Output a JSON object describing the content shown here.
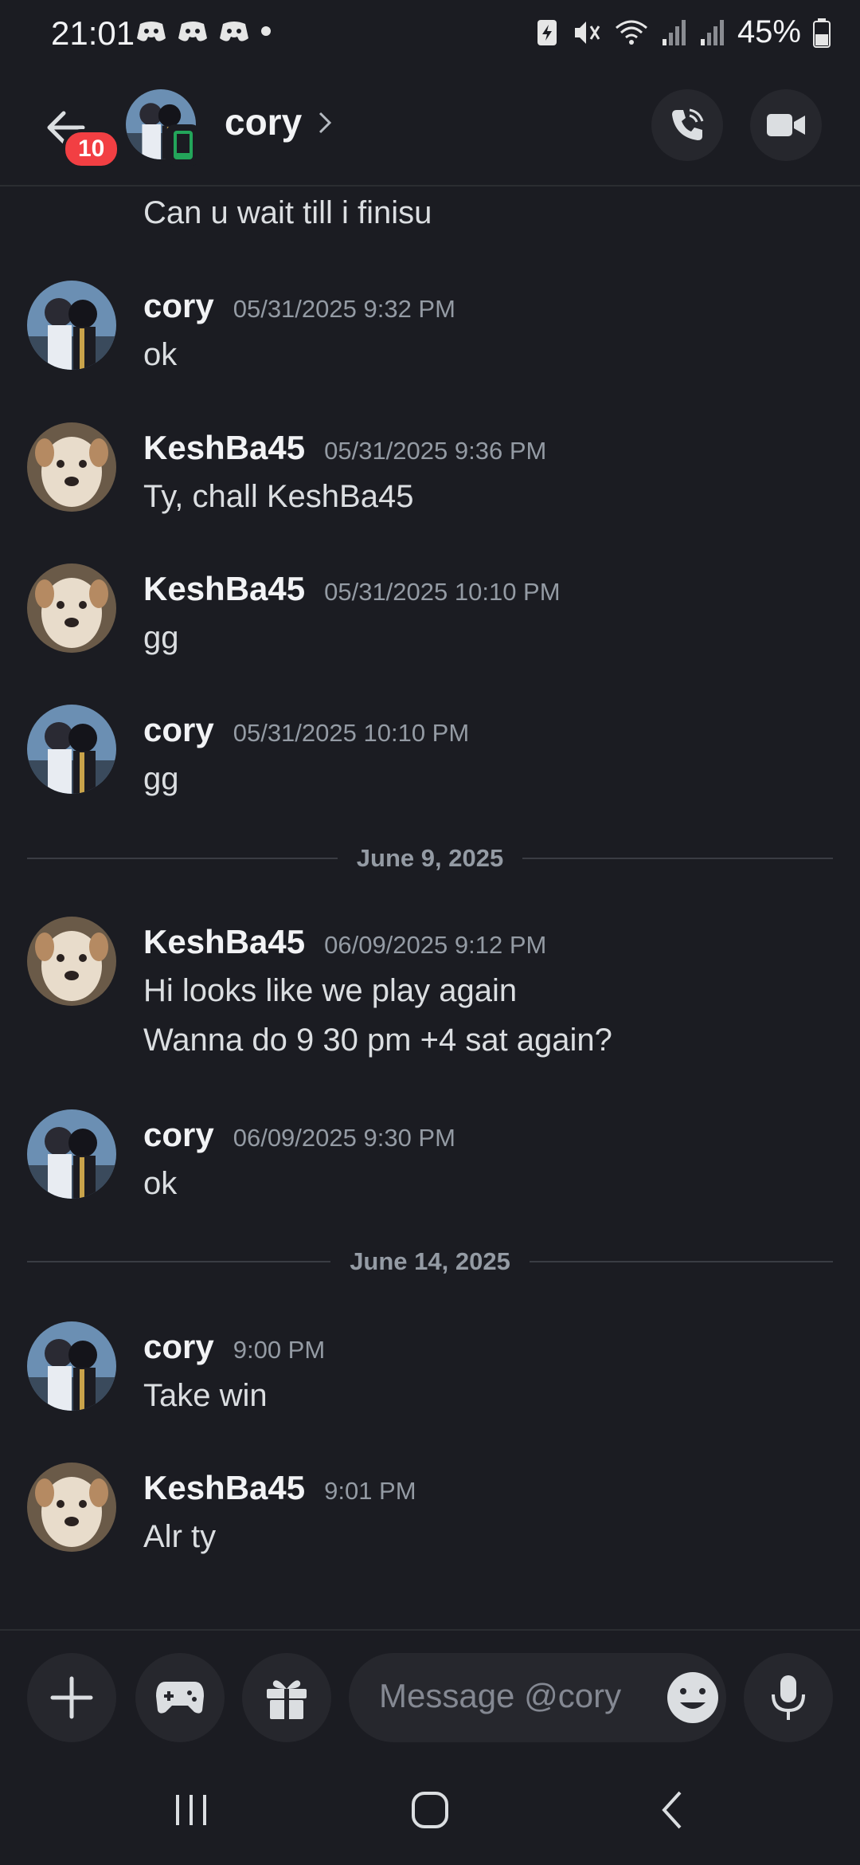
{
  "status_bar": {
    "time": "21:01",
    "battery_pct": "45%"
  },
  "header": {
    "back_badge": "10",
    "contact_name": "cory"
  },
  "messages": {
    "partial": {
      "text": "Can u wait till i finisu"
    },
    "m1": {
      "author": "cory",
      "timestamp": "05/31/2025 9:32 PM",
      "text": "ok"
    },
    "m2": {
      "author": "KeshBa45",
      "timestamp": "05/31/2025 9:36 PM",
      "text": "Ty, chall KeshBa45"
    },
    "m3": {
      "author": "KeshBa45",
      "timestamp": "05/31/2025 10:10 PM",
      "text": "gg"
    },
    "m4": {
      "author": "cory",
      "timestamp": "05/31/2025 10:10 PM",
      "text": "gg"
    },
    "divider1": "June 9, 2025",
    "m5": {
      "author": "KeshBa45",
      "timestamp": "06/09/2025 9:12 PM",
      "line1": "Hi looks like we play again",
      "line2": "Wanna do 9 30 pm +4 sat again?"
    },
    "m6": {
      "author": "cory",
      "timestamp": "06/09/2025 9:30 PM",
      "text": "ok"
    },
    "divider2": "June 14, 2025",
    "m7": {
      "author": "cory",
      "timestamp": "9:00 PM",
      "text": "Take win"
    },
    "m8": {
      "author": "KeshBa45",
      "timestamp": "9:01 PM",
      "text": "Alr ty"
    }
  },
  "composer": {
    "placeholder": "Message @cory"
  },
  "colors": {
    "background": "#1b1c22",
    "badge_red": "#f23f43",
    "online_green": "#23a55a"
  }
}
